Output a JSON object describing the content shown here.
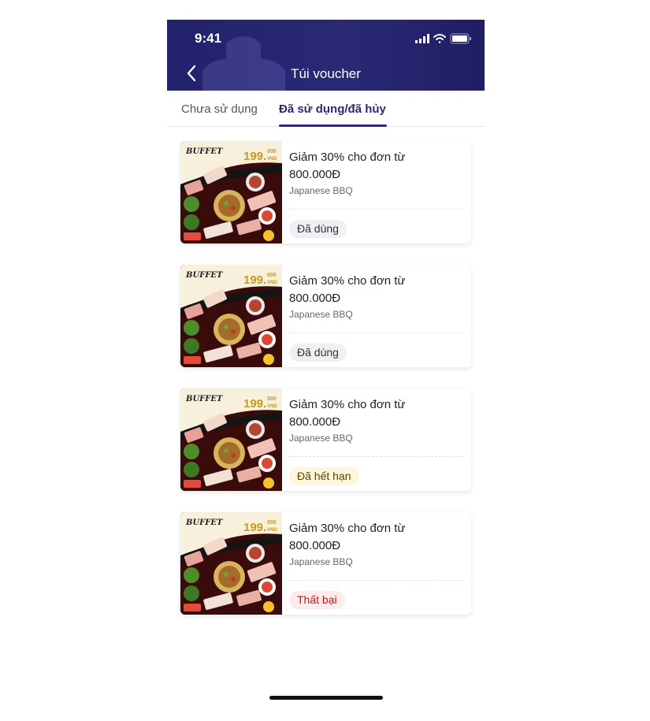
{
  "status_bar": {
    "time": "9:41"
  },
  "header": {
    "title": "Túi voucher",
    "back_icon": "chevron-left-icon"
  },
  "tabs": [
    {
      "label": "Chưa sử dụng",
      "active": false
    },
    {
      "label": "Đã sử dụng/đã hủy",
      "active": true
    }
  ],
  "image_text": {
    "buffet": "BUFFET",
    "price": "199.",
    "price_small": "000",
    "currency": "VND"
  },
  "vouchers": [
    {
      "title": "Giảm 30% cho đơn từ 800.000Đ",
      "brand": "Japanese BBQ",
      "status": "Đã dùng",
      "status_color": "#eef0f4"
    },
    {
      "title": "Giảm 30% cho đơn từ 800.000Đ",
      "brand": "Japanese BBQ",
      "status": "Đã dùng",
      "status_color": "#eef0f4"
    },
    {
      "title": "Giảm 30% cho đơn từ 800.000Đ",
      "brand": "Japanese BBQ",
      "status": "Đã hết hạn",
      "status_color": "#fdf5dc"
    },
    {
      "title": "Giảm 30% cho đơn từ 800.000Đ",
      "brand": "Japanese BBQ",
      "status": "Thất bại",
      "status_color": "#fdecec"
    }
  ],
  "colors": {
    "header": "#22216b",
    "accent": "#2a2976",
    "failed_text": "#d0121b"
  }
}
